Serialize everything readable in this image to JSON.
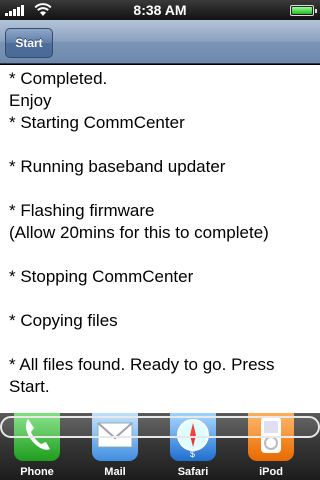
{
  "status_bar": {
    "time": "8:38 AM"
  },
  "nav": {
    "start_label": "Start"
  },
  "log": {
    "lines": [
      "* Completed.",
      "Enjoy",
      "* Starting CommCenter",
      "",
      "* Running baseband updater",
      "",
      "* Flashing firmware",
      "(Allow 20mins for this to complete)",
      "",
      "* Stopping CommCenter",
      "",
      "* Copying files",
      "",
      "* All files found. Ready to go. Press",
      "Start."
    ]
  },
  "dock": {
    "items": [
      {
        "label": "Phone",
        "icon": "phone-icon"
      },
      {
        "label": "Mail",
        "icon": "mail-icon"
      },
      {
        "label": "Safari",
        "icon": "safari-icon"
      },
      {
        "label": "iPod",
        "icon": "ipod-icon"
      }
    ]
  },
  "colors": {
    "nav": "#6d89ad",
    "battery": "#22bb22",
    "phone": "#1e9e1e",
    "ipod": "#e86a00"
  }
}
